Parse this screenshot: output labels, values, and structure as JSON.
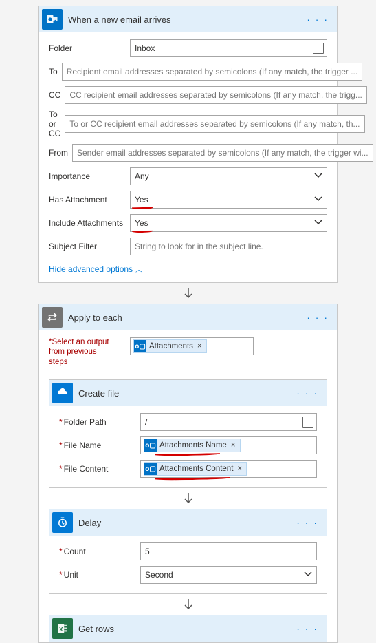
{
  "trigger": {
    "title": "When a new email arrives",
    "dots": "· · ·",
    "fields": {
      "folder": {
        "label": "Folder",
        "value": "Inbox"
      },
      "to": {
        "label": "To",
        "placeholder": "Recipient email addresses separated by semicolons (If any match, the trigger ..."
      },
      "cc": {
        "label": "CC",
        "placeholder": "CC recipient email addresses separated by semicolons (If any match, the trigg..."
      },
      "toOrCc": {
        "label": "To or CC",
        "placeholder": "To or CC recipient email addresses separated by semicolons (If any match, th..."
      },
      "from": {
        "label": "From",
        "placeholder": "Sender email addresses separated by semicolons (If any match, the trigger wi..."
      },
      "importance": {
        "label": "Importance",
        "value": "Any"
      },
      "hasAttachment": {
        "label": "Has Attachment",
        "value": "Yes"
      },
      "includeAtt": {
        "label": "Include Attachments",
        "value": "Yes"
      },
      "subject": {
        "label": "Subject Filter",
        "placeholder": "String to look for in the subject line."
      }
    },
    "advancedToggle": "Hide advanced options"
  },
  "applyToEach": {
    "title": "Apply to each",
    "dots": "· · ·",
    "selectOutputLabel": "Select an output from previous steps",
    "token": "Attachments"
  },
  "createFile": {
    "title": "Create file",
    "dots": "· · ·",
    "fields": {
      "folderPath": {
        "label": "Folder Path",
        "value": "/"
      },
      "fileName": {
        "label": "File Name",
        "token": "Attachments Name"
      },
      "fileContent": {
        "label": "File Content",
        "token": "Attachments Content"
      }
    }
  },
  "delay": {
    "title": "Delay",
    "dots": "· · ·",
    "fields": {
      "count": {
        "label": "Count",
        "value": "5"
      },
      "unit": {
        "label": "Unit",
        "value": "Second"
      }
    }
  },
  "getRows": {
    "title": "Get rows",
    "dots": "· · ·"
  }
}
